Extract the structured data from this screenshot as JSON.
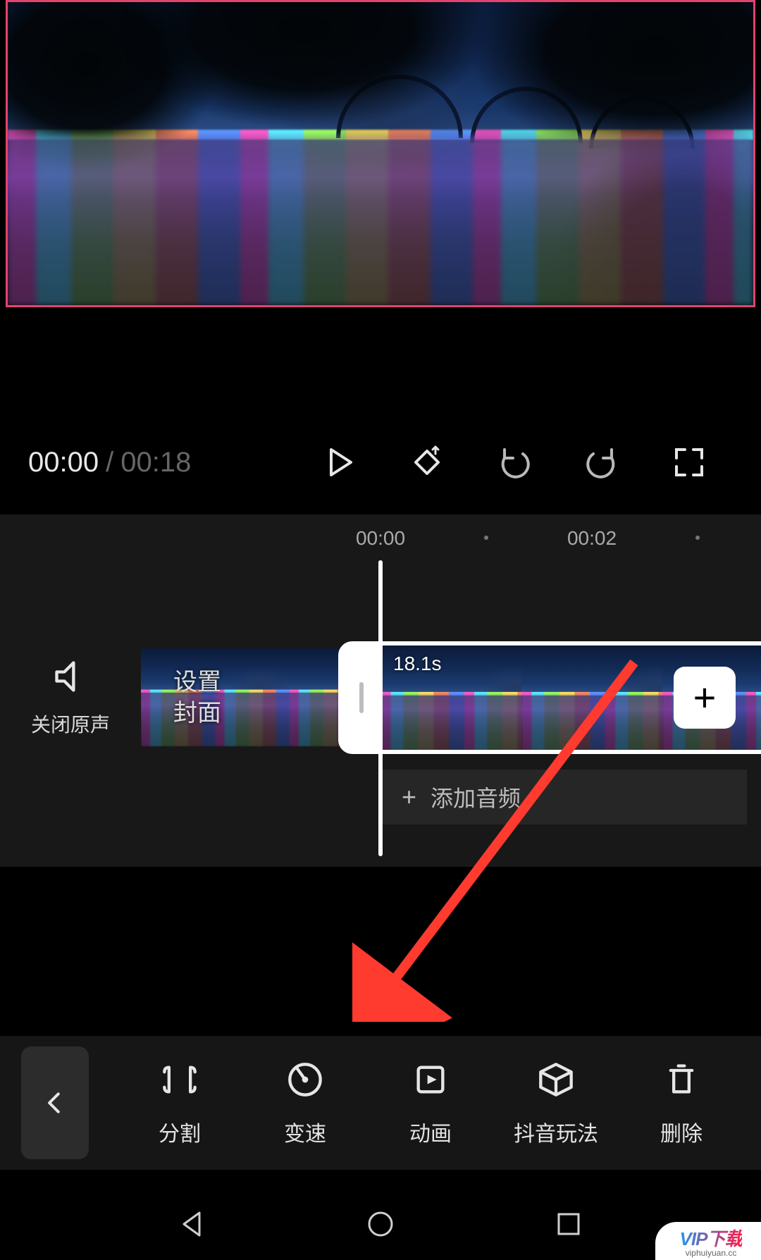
{
  "transport": {
    "current_time": "00:00",
    "separator": "/",
    "total_time": "00:18"
  },
  "ruler": {
    "t1": "00:00",
    "t2": "00:02"
  },
  "mute": {
    "label": "关闭原声"
  },
  "cover": {
    "label_line1": "设置",
    "label_line2": "封面"
  },
  "clip": {
    "duration": "18.1s"
  },
  "audio_row": {
    "icon": "+",
    "label": "添加音频"
  },
  "toolbar": {
    "items": [
      {
        "label": "分割"
      },
      {
        "label": "变速"
      },
      {
        "label": "动画"
      },
      {
        "label": "抖音玩法"
      },
      {
        "label": "删除"
      }
    ]
  },
  "watermark": {
    "brand": "VIP下载",
    "url": "viphuiyuan.cc"
  },
  "add_button": "+"
}
